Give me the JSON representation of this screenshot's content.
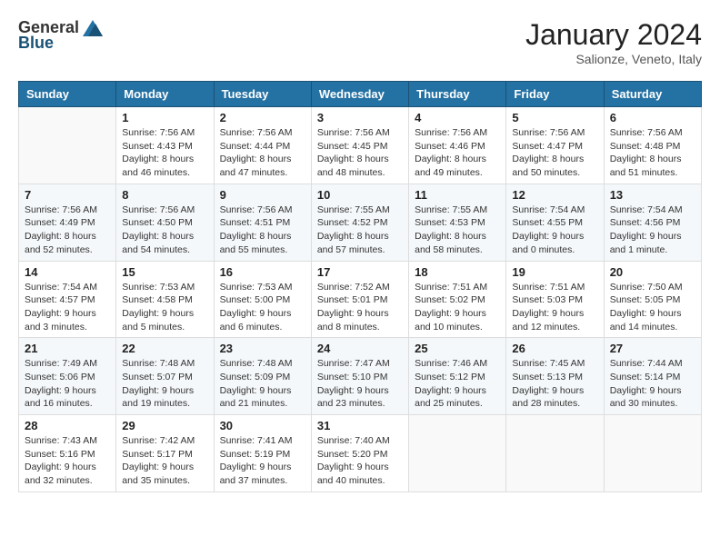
{
  "header": {
    "logo_general": "General",
    "logo_blue": "Blue",
    "month_year": "January 2024",
    "location": "Salionze, Veneto, Italy"
  },
  "weekdays": [
    "Sunday",
    "Monday",
    "Tuesday",
    "Wednesday",
    "Thursday",
    "Friday",
    "Saturday"
  ],
  "weeks": [
    [
      {
        "day": "",
        "info": ""
      },
      {
        "day": "1",
        "info": "Sunrise: 7:56 AM\nSunset: 4:43 PM\nDaylight: 8 hours\nand 46 minutes."
      },
      {
        "day": "2",
        "info": "Sunrise: 7:56 AM\nSunset: 4:44 PM\nDaylight: 8 hours\nand 47 minutes."
      },
      {
        "day": "3",
        "info": "Sunrise: 7:56 AM\nSunset: 4:45 PM\nDaylight: 8 hours\nand 48 minutes."
      },
      {
        "day": "4",
        "info": "Sunrise: 7:56 AM\nSunset: 4:46 PM\nDaylight: 8 hours\nand 49 minutes."
      },
      {
        "day": "5",
        "info": "Sunrise: 7:56 AM\nSunset: 4:47 PM\nDaylight: 8 hours\nand 50 minutes."
      },
      {
        "day": "6",
        "info": "Sunrise: 7:56 AM\nSunset: 4:48 PM\nDaylight: 8 hours\nand 51 minutes."
      }
    ],
    [
      {
        "day": "7",
        "info": "Sunrise: 7:56 AM\nSunset: 4:49 PM\nDaylight: 8 hours\nand 52 minutes."
      },
      {
        "day": "8",
        "info": "Sunrise: 7:56 AM\nSunset: 4:50 PM\nDaylight: 8 hours\nand 54 minutes."
      },
      {
        "day": "9",
        "info": "Sunrise: 7:56 AM\nSunset: 4:51 PM\nDaylight: 8 hours\nand 55 minutes."
      },
      {
        "day": "10",
        "info": "Sunrise: 7:55 AM\nSunset: 4:52 PM\nDaylight: 8 hours\nand 57 minutes."
      },
      {
        "day": "11",
        "info": "Sunrise: 7:55 AM\nSunset: 4:53 PM\nDaylight: 8 hours\nand 58 minutes."
      },
      {
        "day": "12",
        "info": "Sunrise: 7:54 AM\nSunset: 4:55 PM\nDaylight: 9 hours\nand 0 minutes."
      },
      {
        "day": "13",
        "info": "Sunrise: 7:54 AM\nSunset: 4:56 PM\nDaylight: 9 hours\nand 1 minute."
      }
    ],
    [
      {
        "day": "14",
        "info": "Sunrise: 7:54 AM\nSunset: 4:57 PM\nDaylight: 9 hours\nand 3 minutes."
      },
      {
        "day": "15",
        "info": "Sunrise: 7:53 AM\nSunset: 4:58 PM\nDaylight: 9 hours\nand 5 minutes."
      },
      {
        "day": "16",
        "info": "Sunrise: 7:53 AM\nSunset: 5:00 PM\nDaylight: 9 hours\nand 6 minutes."
      },
      {
        "day": "17",
        "info": "Sunrise: 7:52 AM\nSunset: 5:01 PM\nDaylight: 9 hours\nand 8 minutes."
      },
      {
        "day": "18",
        "info": "Sunrise: 7:51 AM\nSunset: 5:02 PM\nDaylight: 9 hours\nand 10 minutes."
      },
      {
        "day": "19",
        "info": "Sunrise: 7:51 AM\nSunset: 5:03 PM\nDaylight: 9 hours\nand 12 minutes."
      },
      {
        "day": "20",
        "info": "Sunrise: 7:50 AM\nSunset: 5:05 PM\nDaylight: 9 hours\nand 14 minutes."
      }
    ],
    [
      {
        "day": "21",
        "info": "Sunrise: 7:49 AM\nSunset: 5:06 PM\nDaylight: 9 hours\nand 16 minutes."
      },
      {
        "day": "22",
        "info": "Sunrise: 7:48 AM\nSunset: 5:07 PM\nDaylight: 9 hours\nand 19 minutes."
      },
      {
        "day": "23",
        "info": "Sunrise: 7:48 AM\nSunset: 5:09 PM\nDaylight: 9 hours\nand 21 minutes."
      },
      {
        "day": "24",
        "info": "Sunrise: 7:47 AM\nSunset: 5:10 PM\nDaylight: 9 hours\nand 23 minutes."
      },
      {
        "day": "25",
        "info": "Sunrise: 7:46 AM\nSunset: 5:12 PM\nDaylight: 9 hours\nand 25 minutes."
      },
      {
        "day": "26",
        "info": "Sunrise: 7:45 AM\nSunset: 5:13 PM\nDaylight: 9 hours\nand 28 minutes."
      },
      {
        "day": "27",
        "info": "Sunrise: 7:44 AM\nSunset: 5:14 PM\nDaylight: 9 hours\nand 30 minutes."
      }
    ],
    [
      {
        "day": "28",
        "info": "Sunrise: 7:43 AM\nSunset: 5:16 PM\nDaylight: 9 hours\nand 32 minutes."
      },
      {
        "day": "29",
        "info": "Sunrise: 7:42 AM\nSunset: 5:17 PM\nDaylight: 9 hours\nand 35 minutes."
      },
      {
        "day": "30",
        "info": "Sunrise: 7:41 AM\nSunset: 5:19 PM\nDaylight: 9 hours\nand 37 minutes."
      },
      {
        "day": "31",
        "info": "Sunrise: 7:40 AM\nSunset: 5:20 PM\nDaylight: 9 hours\nand 40 minutes."
      },
      {
        "day": "",
        "info": ""
      },
      {
        "day": "",
        "info": ""
      },
      {
        "day": "",
        "info": ""
      }
    ]
  ]
}
